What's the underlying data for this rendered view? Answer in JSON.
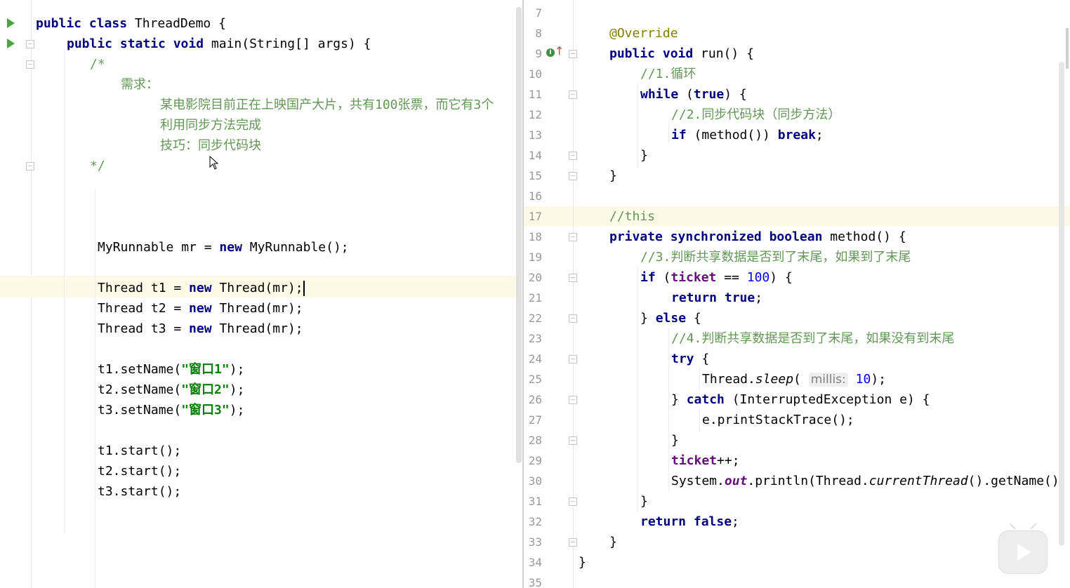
{
  "left": {
    "lines": [
      [
        {
          "t": "public class ",
          "c": "kw"
        },
        {
          "t": "ThreadDemo {",
          "c": ""
        }
      ],
      [
        {
          "t": "public static void ",
          "c": "kw"
        },
        {
          "t": "main(String[] args) {",
          "c": ""
        }
      ],
      [
        {
          "t": "/*",
          "c": "cmz"
        }
      ],
      [
        {
          "t": "需求：",
          "c": "dcm"
        }
      ],
      [
        {
          "t": "某电影院目前正在上映国产大片，共有",
          "c": "dcm"
        },
        {
          "t": "100",
          "c": "cmz"
        },
        {
          "t": "张票，而它有",
          "c": "dcm"
        },
        {
          "t": "3",
          "c": "cmz"
        },
        {
          "t": "个",
          "c": "dcm"
        }
      ],
      [
        {
          "t": "利用同步方法完成",
          "c": "dcm"
        }
      ],
      [
        {
          "t": "技巧：同步代码块",
          "c": "dcm"
        }
      ],
      [
        {
          "t": "*/",
          "c": "cmz"
        }
      ],
      [],
      [],
      [],
      [
        {
          "t": "MyRunnable mr = ",
          "c": ""
        },
        {
          "t": "new ",
          "c": "kw"
        },
        {
          "t": "MyRunnable();",
          "c": ""
        }
      ],
      [],
      [
        {
          "t": "Thread t1 = ",
          "c": ""
        },
        {
          "t": "new ",
          "c": "kw"
        },
        {
          "t": "Thread(mr);",
          "c": ""
        }
      ],
      [
        {
          "t": "Thread t2 = ",
          "c": ""
        },
        {
          "t": "new ",
          "c": "kw"
        },
        {
          "t": "Thread(mr);",
          "c": ""
        }
      ],
      [
        {
          "t": "Thread t3 = ",
          "c": ""
        },
        {
          "t": "new ",
          "c": "kw"
        },
        {
          "t": "Thread(mr);",
          "c": ""
        }
      ],
      [],
      [
        {
          "t": "t1.setName(",
          "c": ""
        },
        {
          "t": "\"窗口1\"",
          "c": "str"
        },
        {
          "t": ");",
          "c": ""
        }
      ],
      [
        {
          "t": "t2.setName(",
          "c": ""
        },
        {
          "t": "\"窗口2\"",
          "c": "str"
        },
        {
          "t": ");",
          "c": ""
        }
      ],
      [
        {
          "t": "t3.setName(",
          "c": ""
        },
        {
          "t": "\"窗口3\"",
          "c": "str"
        },
        {
          "t": ");",
          "c": ""
        }
      ],
      [],
      [
        {
          "t": "t1.start();",
          "c": ""
        }
      ],
      [
        {
          "t": "t2.start();",
          "c": ""
        }
      ],
      [
        {
          "t": "t3.start();",
          "c": ""
        }
      ]
    ]
  },
  "right": {
    "line_numbers": [
      "7",
      "8",
      "9",
      "10",
      "11",
      "12",
      "13",
      "14",
      "15",
      "16",
      "17",
      "18",
      "19",
      "20",
      "21",
      "22",
      "23",
      "24",
      "25",
      "26",
      "27",
      "28",
      "29",
      "30",
      "31",
      "32",
      "33",
      "34",
      "35"
    ],
    "lines": [
      [],
      [
        {
          "t": "@Override",
          "c": "ann"
        }
      ],
      [
        {
          "t": "public void ",
          "c": "kw"
        },
        {
          "t": "run() {",
          "c": ""
        }
      ],
      [
        {
          "t": "//1.",
          "c": "cmz"
        },
        {
          "t": "循环",
          "c": "dcm"
        }
      ],
      [
        {
          "t": "while ",
          "c": "kw"
        },
        {
          "t": "(",
          "c": ""
        },
        {
          "t": "true",
          "c": "kw"
        },
        {
          "t": ") {",
          "c": ""
        }
      ],
      [
        {
          "t": "//2.",
          "c": "cmz"
        },
        {
          "t": "同步代码块（同步方法）",
          "c": "dcm"
        }
      ],
      [
        {
          "t": "if ",
          "c": "kw"
        },
        {
          "t": "(method()) ",
          "c": ""
        },
        {
          "t": "break",
          "c": "kw"
        },
        {
          "t": ";",
          "c": ""
        }
      ],
      [
        {
          "t": "}",
          "c": ""
        }
      ],
      [
        {
          "t": "}",
          "c": ""
        }
      ],
      [],
      [
        {
          "t": "//this",
          "c": "cmz"
        }
      ],
      [
        {
          "t": "private synchronized boolean ",
          "c": "kw"
        },
        {
          "t": "method() {",
          "c": ""
        }
      ],
      [
        {
          "t": "//3.",
          "c": "cmz"
        },
        {
          "t": "判断共享数据是否到了末尾，如果到了末尾",
          "c": "dcm"
        }
      ],
      [
        {
          "t": "if ",
          "c": "kw"
        },
        {
          "t": "(",
          "c": ""
        },
        {
          "t": "ticket ",
          "c": "fld"
        },
        {
          "t": "== ",
          "c": ""
        },
        {
          "t": "100",
          "c": "num"
        },
        {
          "t": ") {",
          "c": ""
        }
      ],
      [
        {
          "t": "return true",
          "c": "kw"
        },
        {
          "t": ";",
          "c": ""
        }
      ],
      [
        {
          "t": "} ",
          "c": ""
        },
        {
          "t": "else ",
          "c": "kw"
        },
        {
          "t": "{",
          "c": ""
        }
      ],
      [
        {
          "t": "//4.",
          "c": "cmz"
        },
        {
          "t": "判断共享数据是否到了末尾，如果没有到末尾",
          "c": "dcm"
        }
      ],
      [
        {
          "t": "try ",
          "c": "kw"
        },
        {
          "t": "{",
          "c": ""
        }
      ],
      [
        {
          "t": "Thread.",
          "c": ""
        },
        {
          "t": "sleep",
          "c": "it"
        },
        {
          "t": "( ",
          "c": ""
        },
        {
          "t": "millis:",
          "c": "hint"
        },
        {
          "t": " ",
          "c": ""
        },
        {
          "t": "10",
          "c": "num"
        },
        {
          "t": ");",
          "c": ""
        }
      ],
      [
        {
          "t": "} ",
          "c": ""
        },
        {
          "t": "catch ",
          "c": "kw"
        },
        {
          "t": "(InterruptedException e) {",
          "c": ""
        }
      ],
      [
        {
          "t": "e.printStackTrace();",
          "c": ""
        }
      ],
      [
        {
          "t": "}",
          "c": ""
        }
      ],
      [
        {
          "t": "ticket",
          "c": "fld"
        },
        {
          "t": "++;",
          "c": ""
        }
      ],
      [
        {
          "t": "System.",
          "c": ""
        },
        {
          "t": "out",
          "c": "sfld"
        },
        {
          "t": ".println(Thread.",
          "c": ""
        },
        {
          "t": "currentThread",
          "c": "it"
        },
        {
          "t": "().getName()",
          "c": ""
        }
      ],
      [
        {
          "t": "}",
          "c": ""
        }
      ],
      [
        {
          "t": "return false",
          "c": "kw"
        },
        {
          "t": ";",
          "c": ""
        }
      ],
      [
        {
          "t": "}",
          "c": ""
        }
      ],
      [
        {
          "t": "}",
          "c": ""
        }
      ],
      []
    ]
  }
}
